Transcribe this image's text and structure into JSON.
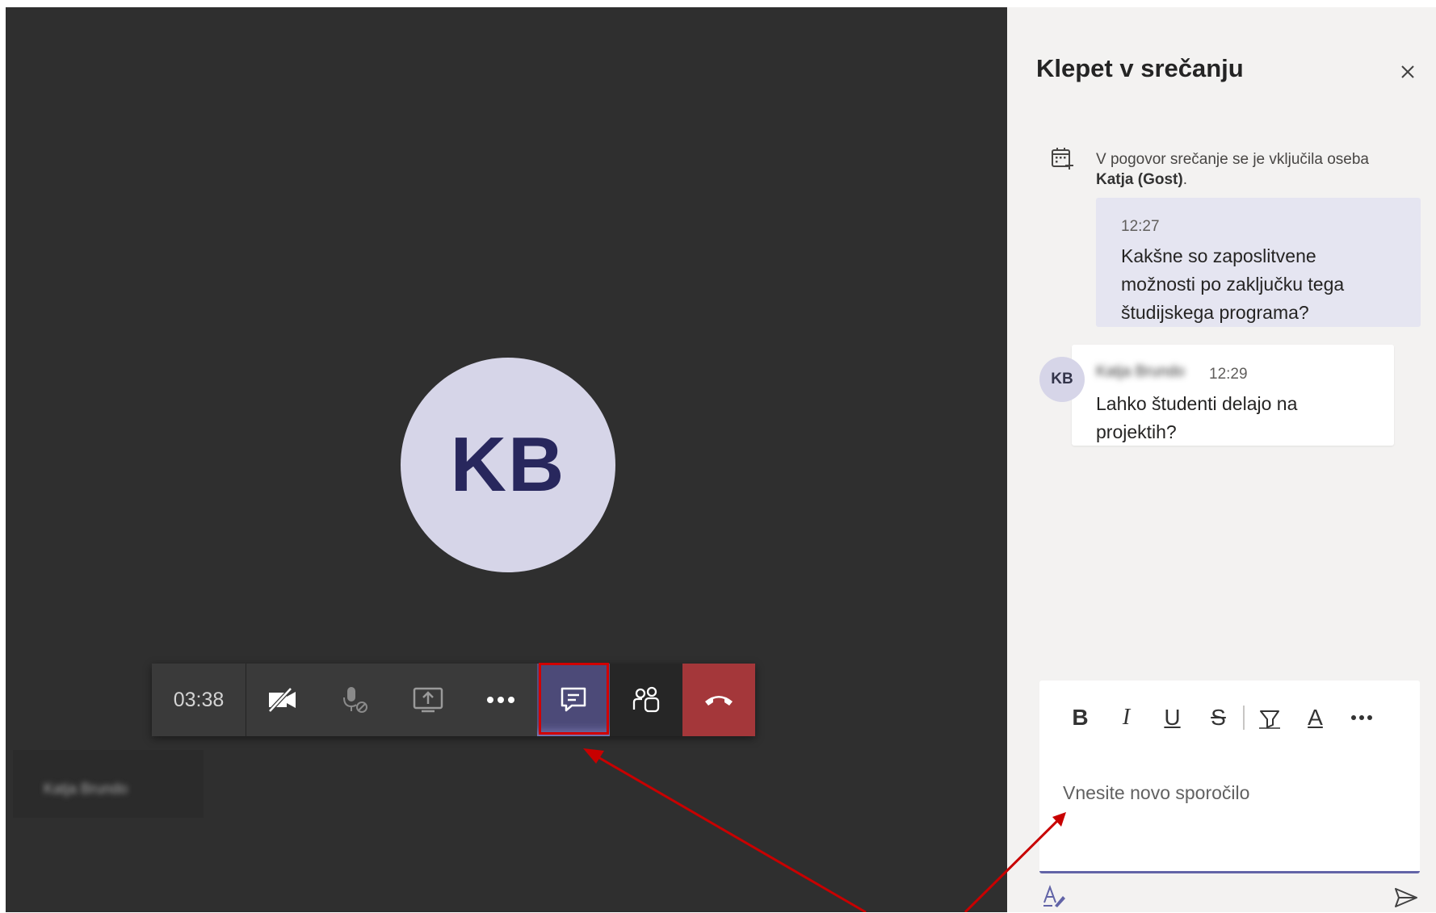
{
  "call": {
    "avatar_initials": "KB",
    "participant_name": "Katja Brundo",
    "toolbar": {
      "timer": "03:38",
      "buttons": [
        {
          "name": "camera-off",
          "icon": "video-off-icon"
        },
        {
          "name": "mic",
          "icon": "mic-off-icon"
        },
        {
          "name": "share",
          "icon": "share-screen-icon"
        },
        {
          "name": "more",
          "icon": "more-icon"
        },
        {
          "name": "chat",
          "icon": "chat-icon",
          "active": true
        },
        {
          "name": "participants",
          "icon": "people-icon"
        },
        {
          "name": "hang-up",
          "icon": "hang-up-icon"
        }
      ]
    }
  },
  "chat": {
    "title": "Klepet v srečanju",
    "system_message": {
      "text": "V pogovor srečanje se je vključila oseba",
      "person": "Katja (Gost)",
      "suffix": "."
    },
    "messages": [
      {
        "time": "12:27",
        "body": "Kakšne so zaposlitvene možnosti po zaključku tega študijskega programa?"
      },
      {
        "sender": "Katja Brundo",
        "initials": "KB",
        "time": "12:29",
        "body": "Lahko študenti delajo na projektih?"
      }
    ],
    "compose": {
      "placeholder": "Vnesite novo sporočilo",
      "format_buttons": [
        "B",
        "I",
        "U",
        "S",
        "highlight",
        "A",
        "more"
      ]
    }
  },
  "colors": {
    "stage_bg": "#2f2f2f",
    "panel_bg": "#f3f2f1",
    "accent": "#6264a7",
    "hangup": "#a4373a",
    "annotation": "#d10000"
  }
}
